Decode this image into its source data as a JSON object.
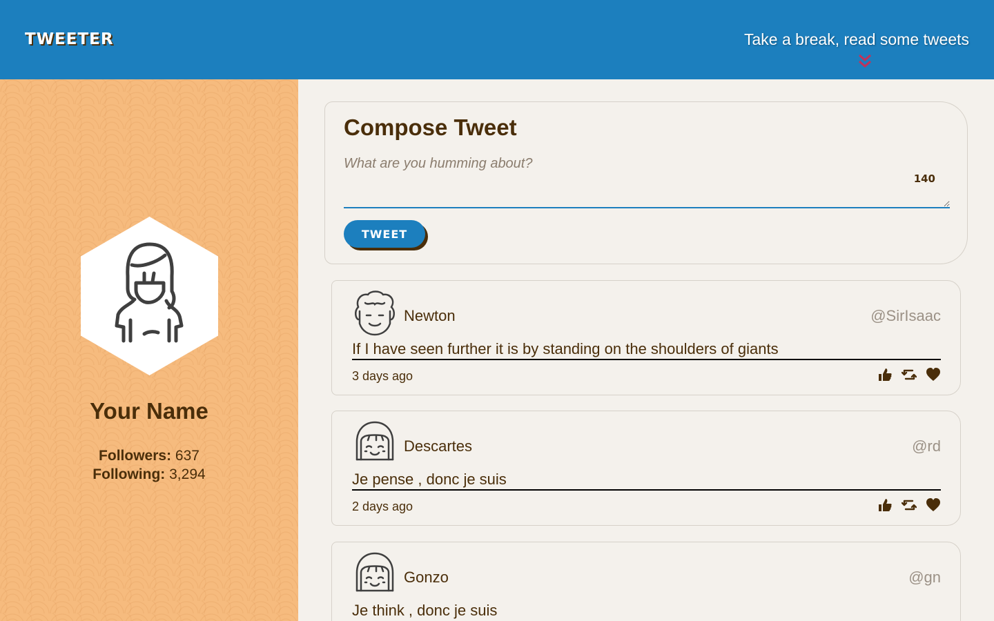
{
  "nav": {
    "brand": "TWEETER",
    "cta": "Take a break, read some tweets",
    "chevron_icon": "double-chevron-down-icon"
  },
  "profile": {
    "name": "Your Name",
    "followers_label": "Followers:",
    "followers_value": "637",
    "following_label": "Following:",
    "following_value": "3,294",
    "avatar_icon": "user-avatar-icon"
  },
  "compose": {
    "title": "Compose Tweet",
    "placeholder": "What are you humming about?",
    "counter": "140",
    "button_label": "TWEET"
  },
  "tweets": [
    {
      "name": "Newton",
      "handle": "@SirIsaac",
      "text": "If I have seen further it is by standing on the shoulders of giants",
      "time": "3 days ago"
    },
    {
      "name": "Descartes",
      "handle": "@rd",
      "text": "Je pense , donc je suis",
      "time": "2 days ago"
    },
    {
      "name": "Gonzo",
      "handle": "@gn",
      "text": "Je think , donc je suis",
      "time": ""
    }
  ],
  "colors": {
    "nav": "#1c7fbe",
    "sidebar": "#f6bb7e",
    "text": "#4a2e0a",
    "page": "#f4f1ec"
  }
}
